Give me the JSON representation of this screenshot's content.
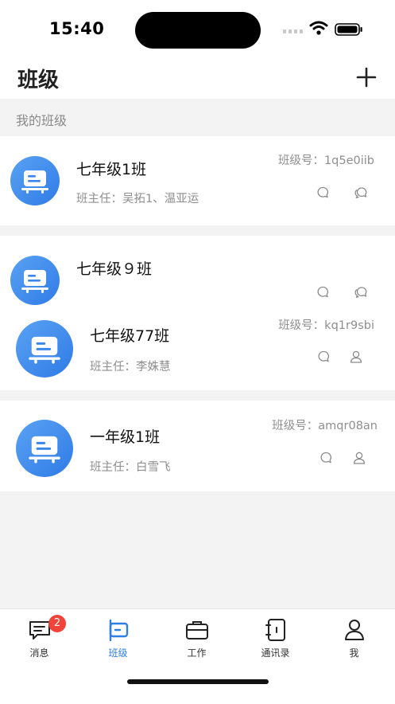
{
  "status": {
    "time": "15:40"
  },
  "header": {
    "title": "班级"
  },
  "section": {
    "label": "我的班级"
  },
  "cards": [
    {
      "name": "七年级1班",
      "teacher": "班主任：吴拓1、温亚运",
      "code": "班级号：1q5e0iib"
    },
    {
      "name": "七年级９班",
      "teacher": "",
      "code": ""
    },
    {
      "name": "七年级77班",
      "teacher": "班主任：李姝慧",
      "code": "班级号：kq1r9sbi"
    },
    {
      "name": "一年级1班",
      "teacher": "班主任：白雪飞",
      "code": "班级号：amqr08an"
    }
  ],
  "tabs": [
    {
      "label": "消息",
      "badge": "2"
    },
    {
      "label": "班级"
    },
    {
      "label": "工作"
    },
    {
      "label": "通讯录"
    },
    {
      "label": "我"
    }
  ],
  "colors": {
    "accent": "#2d7fe6",
    "badge": "#f0443a",
    "avatar": "#3a86ea"
  }
}
